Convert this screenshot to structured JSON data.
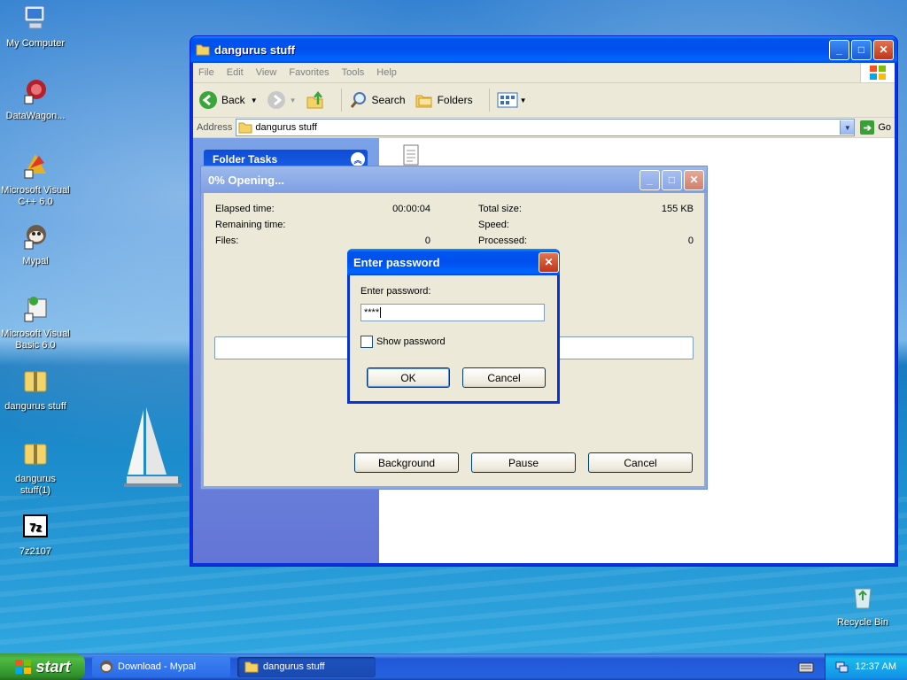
{
  "desktop": {
    "icons": [
      {
        "label": "My Computer"
      },
      {
        "label": "DataWagon..."
      },
      {
        "label": "Microsoft Visual C++ 6.0"
      },
      {
        "label": "Mypal"
      },
      {
        "label": "Microsoft Visual Basic 6.0"
      },
      {
        "label": "dangurus stuff"
      },
      {
        "label": "dangurus stuff(1)"
      },
      {
        "label": "7z2107"
      },
      {
        "label": "Recycle Bin"
      }
    ]
  },
  "explorer": {
    "title": "dangurus stuff",
    "menu": [
      "File",
      "Edit",
      "View",
      "Favorites",
      "Tools",
      "Help"
    ],
    "toolbar": {
      "back": "Back",
      "search": "Search",
      "folders": "Folders"
    },
    "address": {
      "label": "Address",
      "value": "dangurus stuff",
      "go": "Go"
    },
    "folder_tasks": "Folder Tasks"
  },
  "progress": {
    "title": "0% Opening...",
    "elapsed_label": "Elapsed time:",
    "elapsed_value": "00:00:04",
    "remaining_label": "Remaining time:",
    "files_label": "Files:",
    "files_value": "0",
    "total_label": "Total size:",
    "total_value": "155 KB",
    "speed_label": "Speed:",
    "processed_label": "Processed:",
    "processed_value": "0",
    "percent": 0,
    "buttons": {
      "background": "Background",
      "pause": "Pause",
      "cancel": "Cancel"
    }
  },
  "password": {
    "title": "Enter password",
    "label": "Enter password:",
    "value": "****",
    "show_label": "Show password",
    "show_checked": false,
    "ok": "OK",
    "cancel": "Cancel"
  },
  "taskbar": {
    "start": "start",
    "tasks": [
      "Download - Mypal",
      "dangurus stuff"
    ],
    "clock": "12:37 AM"
  }
}
